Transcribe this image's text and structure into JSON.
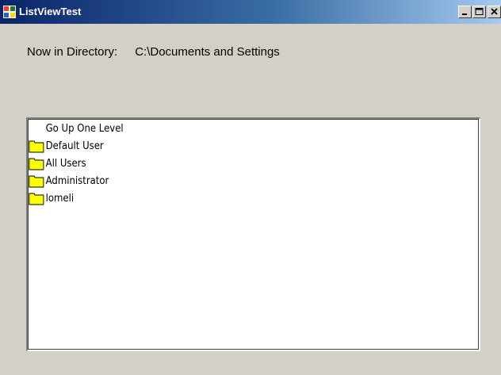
{
  "window": {
    "title": "ListViewTest",
    "icon": "app-window-icon",
    "controls": {
      "minimize_icon": "minimize-icon",
      "maximize_icon": "maximize-icon",
      "close_icon": "close-icon"
    }
  },
  "directory": {
    "label": "Now in Directory:",
    "path": "C:\\Documents and Settings"
  },
  "listview": {
    "items": [
      {
        "label": "Go Up One Level",
        "icon": "none"
      },
      {
        "label": "Default User",
        "icon": "folder-icon"
      },
      {
        "label": "All Users",
        "icon": "folder-icon"
      },
      {
        "label": "Administrator",
        "icon": "folder-icon"
      },
      {
        "label": "lomeli",
        "icon": "folder-icon"
      }
    ]
  },
  "colors": {
    "titlebar_start": "#0a246a",
    "titlebar_end": "#a6caf0",
    "face": "#d4d0c8",
    "folder": "#ffff00"
  }
}
